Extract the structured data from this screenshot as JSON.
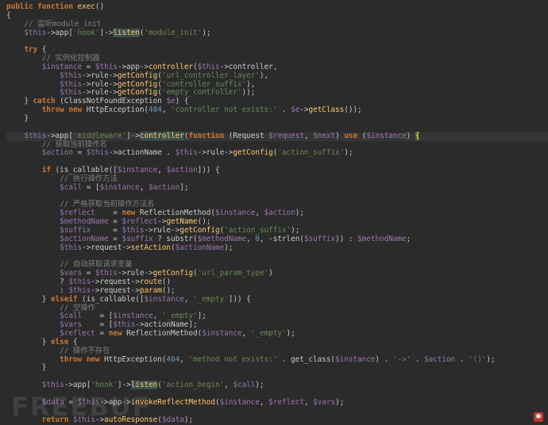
{
  "editor": {
    "language": "php",
    "colors": {
      "background": "#2b2b2b",
      "keyword": "#cc7832",
      "variable": "#9876aa",
      "function": "#ffc66d",
      "string": "#6a8759",
      "comment": "#808080",
      "number": "#6897bb",
      "plain": "#c9c9c9"
    },
    "lines": [
      [
        [
          "kw",
          "public function "
        ],
        [
          "fn",
          "exec"
        ],
        [
          "plain",
          "()"
        ]
      ],
      [
        [
          "plain",
          "{"
        ]
      ],
      [
        [
          "cmt",
          "    // 监听module_init"
        ]
      ],
      [
        [
          "var",
          "    $this"
        ],
        [
          "plain",
          "->app["
        ],
        [
          "str",
          "'hook'"
        ],
        [
          "plain",
          "]->"
        ],
        [
          "hl",
          "listen"
        ],
        [
          "plain",
          "("
        ],
        [
          "str",
          "'module_init'"
        ],
        [
          "plain",
          ");"
        ]
      ],
      [
        [
          "plain",
          ""
        ]
      ],
      [
        [
          "kw",
          "    try "
        ],
        [
          "plain",
          "{"
        ]
      ],
      [
        [
          "cmt",
          "        // 实例化控制器"
        ]
      ],
      [
        [
          "var",
          "        $instance "
        ],
        [
          "plain",
          "= "
        ],
        [
          "var",
          "$this"
        ],
        [
          "plain",
          "->app->"
        ],
        [
          "fn",
          "controller"
        ],
        [
          "plain",
          "("
        ],
        [
          "var",
          "$this"
        ],
        [
          "plain",
          "->controller,"
        ]
      ],
      [
        [
          "var",
          "            $this"
        ],
        [
          "plain",
          "->rule->"
        ],
        [
          "fn",
          "getConfig"
        ],
        [
          "plain",
          "("
        ],
        [
          "str",
          "'url_controller_layer'"
        ],
        [
          "plain",
          "),"
        ]
      ],
      [
        [
          "var",
          "            $this"
        ],
        [
          "plain",
          "->rule->"
        ],
        [
          "fn",
          "getConfig"
        ],
        [
          "plain",
          "("
        ],
        [
          "str",
          "'controller_suffix'"
        ],
        [
          "plain",
          "),"
        ]
      ],
      [
        [
          "var",
          "            $this"
        ],
        [
          "plain",
          "->rule->"
        ],
        [
          "fn",
          "getConfig"
        ],
        [
          "plain",
          "("
        ],
        [
          "str",
          "'empty_controller'"
        ],
        [
          "plain",
          "));"
        ]
      ],
      [
        [
          "plain",
          "    } "
        ],
        [
          "kw",
          "catch "
        ],
        [
          "plain",
          "(ClassNotFoundException "
        ],
        [
          "var",
          "$e"
        ],
        [
          "plain",
          ") {"
        ]
      ],
      [
        [
          "kw",
          "        throw new "
        ],
        [
          "plain",
          "HttpException("
        ],
        [
          "num",
          "404"
        ],
        [
          "plain",
          ", "
        ],
        [
          "str",
          "'controller not exists:' "
        ],
        [
          "plain",
          ". "
        ],
        [
          "var",
          "$e"
        ],
        [
          "plain",
          "->"
        ],
        [
          "fn",
          "getClass"
        ],
        [
          "plain",
          "());"
        ]
      ],
      [
        [
          "plain",
          "    }"
        ]
      ],
      [
        [
          "plain",
          ""
        ]
      ],
      [
        [
          "var",
          "    $this"
        ],
        [
          "plain",
          "->app["
        ],
        [
          "str",
          "'middleware'"
        ],
        [
          "plain",
          "]->"
        ],
        [
          "hl",
          "controller"
        ],
        [
          "plain",
          "("
        ],
        [
          "kw",
          "function "
        ],
        [
          "plain",
          "(Request "
        ],
        [
          "var",
          "$request"
        ],
        [
          "plain",
          ", "
        ],
        [
          "var",
          "$next"
        ],
        [
          "plain",
          ") "
        ],
        [
          "kw",
          "use "
        ],
        [
          "plain",
          "("
        ],
        [
          "var",
          "$instance"
        ],
        [
          "plain",
          ") "
        ],
        [
          "mark",
          "{"
        ]
      ],
      [
        [
          "cmt",
          "        // 获取当前操作名"
        ]
      ],
      [
        [
          "var",
          "        $action "
        ],
        [
          "plain",
          "= "
        ],
        [
          "var",
          "$this"
        ],
        [
          "plain",
          "->actionName . "
        ],
        [
          "var",
          "$this"
        ],
        [
          "plain",
          "->rule->"
        ],
        [
          "fn",
          "getConfig"
        ],
        [
          "plain",
          "("
        ],
        [
          "str",
          "'action_suffix'"
        ],
        [
          "plain",
          ");"
        ]
      ],
      [
        [
          "plain",
          ""
        ]
      ],
      [
        [
          "kw",
          "        if "
        ],
        [
          "plain",
          "(is_callable(["
        ],
        [
          "var",
          "$instance"
        ],
        [
          "plain",
          ", "
        ],
        [
          "var",
          "$action"
        ],
        [
          "plain",
          "])) {"
        ]
      ],
      [
        [
          "cmt",
          "            // 执行操作方法"
        ]
      ],
      [
        [
          "var",
          "            $call "
        ],
        [
          "plain",
          "= ["
        ],
        [
          "var",
          "$instance"
        ],
        [
          "plain",
          ", "
        ],
        [
          "var",
          "$action"
        ],
        [
          "plain",
          "];"
        ]
      ],
      [
        [
          "plain",
          ""
        ]
      ],
      [
        [
          "cmt",
          "            // 严格获取当前操作方法名"
        ]
      ],
      [
        [
          "var",
          "            $reflect    "
        ],
        [
          "plain",
          "= "
        ],
        [
          "kw",
          "new "
        ],
        [
          "plain",
          "ReflectionMethod("
        ],
        [
          "var",
          "$instance"
        ],
        [
          "plain",
          ", "
        ],
        [
          "var",
          "$action"
        ],
        [
          "plain",
          ");"
        ]
      ],
      [
        [
          "var",
          "            $methodName "
        ],
        [
          "plain",
          "= "
        ],
        [
          "var",
          "$reflect"
        ],
        [
          "plain",
          "->"
        ],
        [
          "fn",
          "getName"
        ],
        [
          "plain",
          "();"
        ]
      ],
      [
        [
          "var",
          "            $suffix     "
        ],
        [
          "plain",
          "= "
        ],
        [
          "var",
          "$this"
        ],
        [
          "plain",
          "->rule->"
        ],
        [
          "fn",
          "getConfig"
        ],
        [
          "plain",
          "("
        ],
        [
          "str",
          "'action_suffix'"
        ],
        [
          "plain",
          ");"
        ]
      ],
      [
        [
          "var",
          "            $actionName "
        ],
        [
          "plain",
          "= "
        ],
        [
          "var",
          "$suffix "
        ],
        [
          "plain",
          "? substr("
        ],
        [
          "var",
          "$methodName"
        ],
        [
          "plain",
          ", "
        ],
        [
          "num",
          "0"
        ],
        [
          "plain",
          ", -strlen("
        ],
        [
          "var",
          "$suffix"
        ],
        [
          "plain",
          ")) : "
        ],
        [
          "var",
          "$methodName"
        ],
        [
          "plain",
          ";"
        ]
      ],
      [
        [
          "var",
          "            $this"
        ],
        [
          "plain",
          "->request->"
        ],
        [
          "fn",
          "setAction"
        ],
        [
          "plain",
          "("
        ],
        [
          "var",
          "$actionName"
        ],
        [
          "plain",
          ");"
        ]
      ],
      [
        [
          "plain",
          ""
        ]
      ],
      [
        [
          "cmt",
          "            // 自动获取请求变量"
        ]
      ],
      [
        [
          "var",
          "            $vars "
        ],
        [
          "plain",
          "= "
        ],
        [
          "var",
          "$this"
        ],
        [
          "plain",
          "->rule->"
        ],
        [
          "fn",
          "getConfig"
        ],
        [
          "plain",
          "("
        ],
        [
          "str",
          "'url_param_type'"
        ],
        [
          "plain",
          ")"
        ]
      ],
      [
        [
          "plain",
          "            ? "
        ],
        [
          "var",
          "$this"
        ],
        [
          "plain",
          "->request->"
        ],
        [
          "fn",
          "route"
        ],
        [
          "plain",
          "()"
        ]
      ],
      [
        [
          "plain",
          "            : "
        ],
        [
          "var",
          "$this"
        ],
        [
          "plain",
          "->request->"
        ],
        [
          "fn",
          "param"
        ],
        [
          "plain",
          "();"
        ]
      ],
      [
        [
          "plain",
          "        } "
        ],
        [
          "kw",
          "elseif "
        ],
        [
          "plain",
          "(is_callable(["
        ],
        [
          "var",
          "$instance"
        ],
        [
          "plain",
          ", "
        ],
        [
          "str",
          "'_empty'"
        ],
        [
          "plain",
          "])) {"
        ]
      ],
      [
        [
          "cmt",
          "            // 空操作"
        ]
      ],
      [
        [
          "var",
          "            $call    "
        ],
        [
          "plain",
          "= ["
        ],
        [
          "var",
          "$instance"
        ],
        [
          "plain",
          ", "
        ],
        [
          "str",
          "'_empty'"
        ],
        [
          "plain",
          "];"
        ]
      ],
      [
        [
          "var",
          "            $vars    "
        ],
        [
          "plain",
          "= ["
        ],
        [
          "var",
          "$this"
        ],
        [
          "plain",
          "->actionName];"
        ]
      ],
      [
        [
          "var",
          "            $reflect "
        ],
        [
          "plain",
          "= "
        ],
        [
          "kw",
          "new "
        ],
        [
          "plain",
          "ReflectionMethod("
        ],
        [
          "var",
          "$instance"
        ],
        [
          "plain",
          ", "
        ],
        [
          "str",
          "'_empty'"
        ],
        [
          "plain",
          ");"
        ]
      ],
      [
        [
          "plain",
          "        } "
        ],
        [
          "kw",
          "else "
        ],
        [
          "plain",
          "{"
        ]
      ],
      [
        [
          "cmt",
          "            // 操作不存在"
        ]
      ],
      [
        [
          "kw",
          "            throw new "
        ],
        [
          "plain",
          "HttpException("
        ],
        [
          "num",
          "404"
        ],
        [
          "plain",
          ", "
        ],
        [
          "str",
          "'method not exists:' "
        ],
        [
          "plain",
          ". get_class("
        ],
        [
          "var",
          "$instance"
        ],
        [
          "plain",
          ") . "
        ],
        [
          "str",
          "'->' "
        ],
        [
          "plain",
          ". "
        ],
        [
          "var",
          "$action "
        ],
        [
          "plain",
          ". "
        ],
        [
          "str",
          "'()'"
        ],
        [
          "plain",
          ");"
        ]
      ],
      [
        [
          "plain",
          "        }"
        ]
      ],
      [
        [
          "plain",
          ""
        ]
      ],
      [
        [
          "var",
          "        $this"
        ],
        [
          "plain",
          "->app["
        ],
        [
          "str",
          "'hook'"
        ],
        [
          "plain",
          "]->"
        ],
        [
          "hl",
          "listen"
        ],
        [
          "plain",
          "("
        ],
        [
          "str",
          "'action_begin'"
        ],
        [
          "plain",
          ", "
        ],
        [
          "var",
          "$call"
        ],
        [
          "plain",
          ");"
        ]
      ],
      [
        [
          "plain",
          ""
        ]
      ],
      [
        [
          "var",
          "        $data "
        ],
        [
          "plain",
          "= "
        ],
        [
          "var",
          "$this"
        ],
        [
          "plain",
          "->app->"
        ],
        [
          "fn",
          "invokeReflectMethod"
        ],
        [
          "plain",
          "("
        ],
        [
          "var",
          "$instance"
        ],
        [
          "plain",
          ", "
        ],
        [
          "var",
          "$reflect"
        ],
        [
          "plain",
          ", "
        ],
        [
          "var",
          "$vars"
        ],
        [
          "plain",
          ");"
        ]
      ],
      [
        [
          "plain",
          ""
        ]
      ],
      [
        [
          "kw",
          "        return "
        ],
        [
          "var",
          "$this"
        ],
        [
          "plain",
          "->"
        ],
        [
          "fn",
          "autoResponse"
        ],
        [
          "plain",
          "("
        ],
        [
          "var",
          "$data"
        ],
        [
          "plain",
          ");"
        ]
      ]
    ],
    "highlighted_line": 15
  }
}
